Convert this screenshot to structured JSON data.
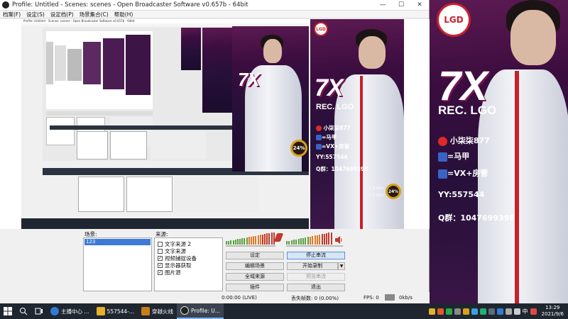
{
  "window": {
    "title": "Profile: Untitled - Scenes: scenes - Open Broadcaster Software v0.657b - 64bit",
    "minimize": "—",
    "maximize": "☐",
    "close": "✕"
  },
  "menu": [
    "档案(F)",
    "设定(S)",
    "设定档(P)",
    "场景集合(C)",
    "帮助(H)"
  ],
  "poster": {
    "logo": "LGD",
    "headline": "7X",
    "subline": "REC. LGO",
    "weibo": "小柒柒877",
    "alias": "=马甲",
    "vx": "=VX+房管",
    "yy": "YY:557544",
    "qq": "Q群：1047699398",
    "up_speed": "2.2",
    "down_speed": "1.2",
    "unit": "K/s",
    "gauge": "24%"
  },
  "scenes": {
    "label": "场景:",
    "items": [
      "123"
    ]
  },
  "sources": {
    "label": "来源:",
    "items": [
      {
        "name": "文字来源 2",
        "checked": false
      },
      {
        "name": "文字来源",
        "checked": false
      },
      {
        "name": "视频捕捉设备",
        "checked": true
      },
      {
        "name": "显示器获取",
        "checked": true
      },
      {
        "name": "图片源",
        "checked": true
      }
    ]
  },
  "buttons": {
    "settings": "设定",
    "stop_stream": "停止串流",
    "edit_scene": "编辑场景",
    "start_record": "开始录制",
    "global_sources": "全域来源",
    "preview_stream": "预览串流",
    "plugins": "插件",
    "exit": "退出"
  },
  "status": {
    "time": "0:00:00 (LIVE)",
    "dropped": "丢失帧数: 0 (0.00%)",
    "fps": "FPS: 0",
    "bitrate": "0kb/s"
  },
  "taskbar": {
    "items": [
      "主播中心 ...",
      "557544-...",
      "穿越火线",
      "Profile: U..."
    ],
    "lang": "中",
    "time": "13:29",
    "date": "2021/9/6"
  }
}
